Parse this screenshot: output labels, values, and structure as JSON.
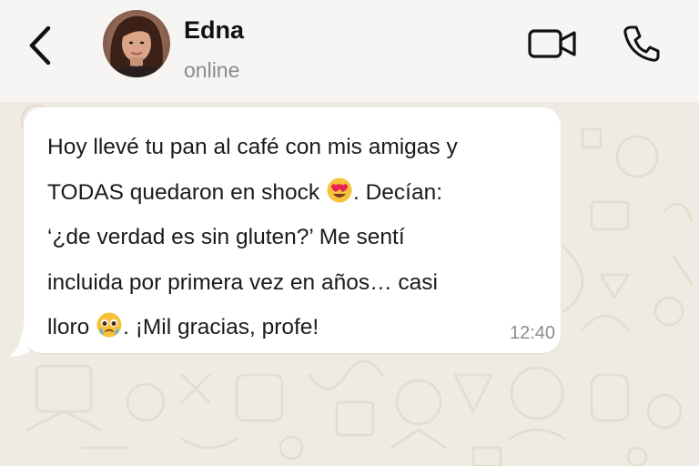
{
  "header": {
    "contact_name": "Edna",
    "status": "online",
    "back_icon": "chevron-left-icon",
    "video_icon": "video-camera-icon",
    "call_icon": "phone-icon"
  },
  "message": {
    "lines": [
      {
        "before": "Hoy llevé tu pan al café con mis amigas y",
        "after": ""
      },
      {
        "before": "TODAS quedaron en shock ",
        "emoji": "heart-eyes-emoji",
        "after": ". Decían:"
      },
      {
        "before": "‘¿de verdad es sin gluten?’ Me sentí",
        "after": ""
      },
      {
        "before": "incluida por primera vez en años… casi",
        "after": ""
      },
      {
        "before": "lloro ",
        "emoji": "pleading-tears-emoji",
        "after": ". ¡Mil gracias, profe!"
      }
    ],
    "time": "12:40"
  },
  "colors": {
    "header_bg": "#f7f5f3",
    "chat_bg": "#efeae2",
    "bubble_bg": "#ffffff",
    "icon": "#111111",
    "status_text": "#8b8b8b"
  }
}
